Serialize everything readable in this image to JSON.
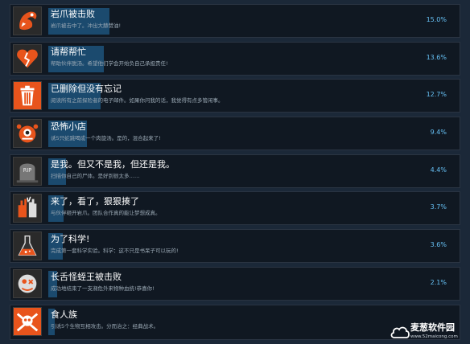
{
  "achievements": [
    {
      "name": "岩爪被击败",
      "desc": "岩爪被击中了。冲出大赫赞油!",
      "percent": "15.0%",
      "progress": 15.0,
      "icon": "orange-claw-icon"
    },
    {
      "name": "请帮帮忙",
      "desc": "帮助伙伴脱汤。希望他们学会开始负自己承担责任!",
      "percent": "13.6%",
      "progress": 13.6,
      "icon": "broken-heart-icon"
    },
    {
      "name": "已删除但没有忘记",
      "desc": "阅读所有之前探险者的电子邮件。如果你问我的话，我觉得有点多管闲事。",
      "percent": "12.7%",
      "progress": 12.7,
      "icon": "trash-can-icon"
    },
    {
      "name": "恐怖小店",
      "desc": "诱5只蛇跳喝成一个肉旋汤。是的，混合起来了!",
      "percent": "9.4%",
      "progress": 9.4,
      "icon": "creature-icon"
    },
    {
      "name": "是我。但又不是我，但还是我。",
      "desc": "扫描你自己的尸体。是好到很太多……",
      "percent": "4.4%",
      "progress": 4.4,
      "icon": "tombstone-icon"
    },
    {
      "name": "来了，看了，狠狠揍了",
      "desc": "与伙伴砸开岩爪。团队合作真的能让梦想成真。",
      "percent": "3.7%",
      "progress": 3.7,
      "icon": "high-five-icon"
    },
    {
      "name": "为了科学!",
      "desc": "完成第一套科学实验。科学：这不只是书呆子可以玩的!",
      "percent": "3.6%",
      "progress": 3.6,
      "icon": "flask-icon"
    },
    {
      "name": "长舌怪蛭王被击败",
      "desc": "成功地结束了一支濒危外来物种血统!恭喜你!",
      "percent": "2.1%",
      "progress": 2.1,
      "icon": "monster-face-icon"
    },
    {
      "name": "食人族",
      "desc": "引诱5个生物互相攻击。分而治之：经典战术。",
      "percent": "",
      "progress": 1.6,
      "icon": "skull-crossbones-icon"
    }
  ],
  "watermark": {
    "title": "麦葱软件园",
    "url": "www.52maicong.com"
  },
  "colors": {
    "background": "#1b2838",
    "row": "#101822",
    "bar": "#1b4a6e",
    "percent_text": "#66c0f4",
    "icon_orange": "#e8541c"
  }
}
